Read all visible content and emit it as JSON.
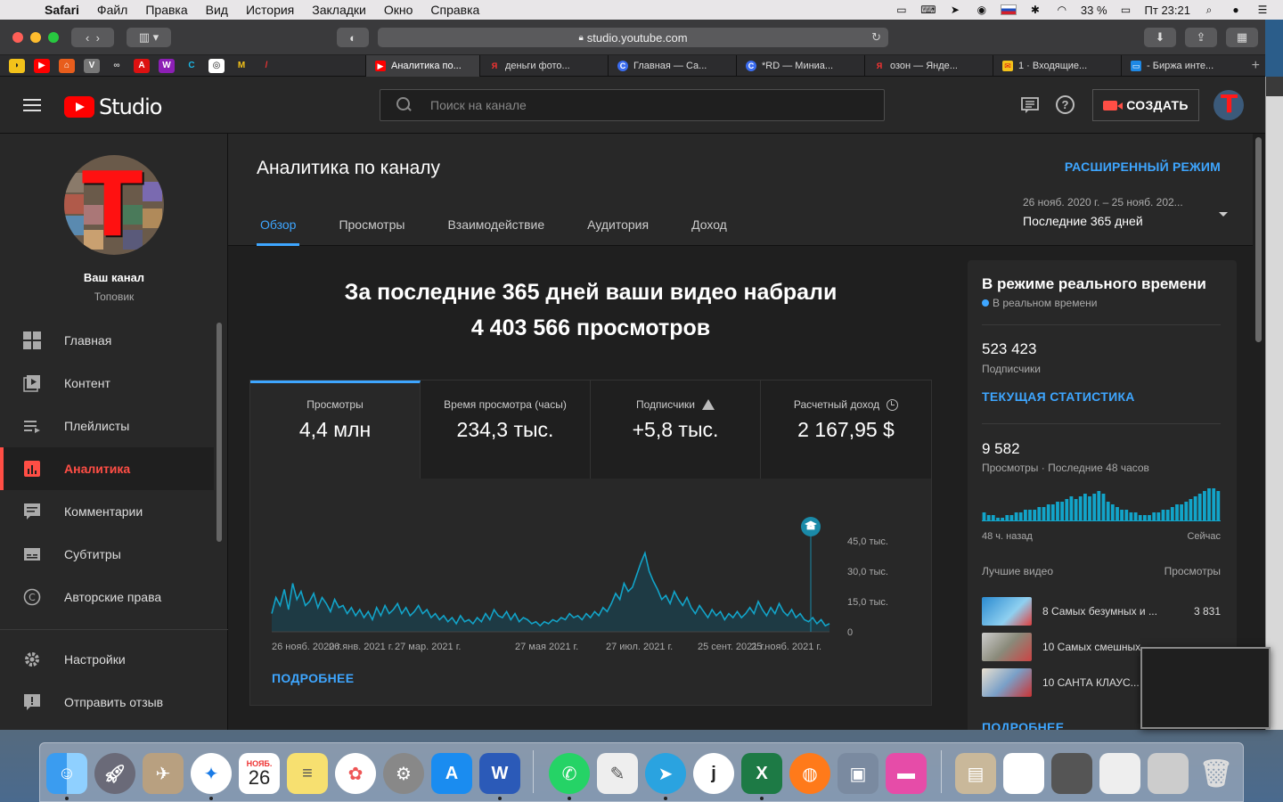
{
  "menubar": {
    "app": "Safari",
    "items": [
      "Файл",
      "Правка",
      "Вид",
      "История",
      "Закладки",
      "Окно",
      "Справка"
    ],
    "battery": "33 %",
    "clock": "Пт 23:21"
  },
  "browser": {
    "url": "studio.youtube.com",
    "tabs": [
      {
        "label": "Аналитика по...",
        "active": true
      },
      {
        "label": "деньги фото..."
      },
      {
        "label": "Главная — Са..."
      },
      {
        "label": "*RD — Миниа..."
      },
      {
        "label": "озон — Янде..."
      },
      {
        "label": "1 · Входящие..."
      },
      {
        "label": "- Биржа инте..."
      }
    ]
  },
  "header": {
    "logo": "Studio",
    "search_placeholder": "Поиск на канале",
    "create_label": "СОЗДАТЬ"
  },
  "sidebar": {
    "channel_name": "Ваш канал",
    "channel_sub": "Топовик",
    "items": [
      {
        "label": "Главная",
        "icon": "dashboard-icon"
      },
      {
        "label": "Контент",
        "icon": "content-icon"
      },
      {
        "label": "Плейлисты",
        "icon": "playlist-icon"
      },
      {
        "label": "Аналитика",
        "icon": "analytics-icon",
        "active": true
      },
      {
        "label": "Комментарии",
        "icon": "comments-icon"
      },
      {
        "label": "Субтитры",
        "icon": "subtitles-icon"
      },
      {
        "label": "Авторские права",
        "icon": "copyright-icon"
      }
    ],
    "bottom": [
      {
        "label": "Настройки",
        "icon": "gear-icon"
      },
      {
        "label": "Отправить отзыв",
        "icon": "feedback-icon"
      }
    ]
  },
  "main": {
    "title": "Аналитика по каналу",
    "advanced_mode": "РАСШИРЕННЫЙ РЕЖИМ",
    "tabs": [
      "Обзор",
      "Просмотры",
      "Взаимодействие",
      "Аудитория",
      "Доход"
    ],
    "date_range": "26 нояб. 2020 г. – 25 нояб. 202...",
    "date_label": "Последние 365 дней",
    "headline_1": "За последние 365 дней ваши видео набрали",
    "headline_2": "4 403 566 просмотров",
    "metrics": [
      {
        "label": "Просмотры",
        "value": "4,4 млн"
      },
      {
        "label": "Время просмотра (часы)",
        "value": "234,3 тыс."
      },
      {
        "label": "Подписчики",
        "value": "+5,8 тыс."
      },
      {
        "label": "Расчетный доход",
        "value": "2 167,95 $"
      }
    ],
    "more_link": "ПОДРОБНЕЕ"
  },
  "chart_data": {
    "type": "area",
    "ylabel_ticks": [
      "0",
      "15,0 тыс.",
      "30,0 тыс.",
      "45,0 тыс."
    ],
    "ylim": [
      0,
      45000
    ],
    "x_ticks": [
      "26 нояб. 2020 г.",
      "26 янв. 2021 г.",
      "27 мар. 2021 г.",
      "27 мая 2021 г.",
      "27 июл. 2021 г.",
      "25 сент. 2021 г.",
      "25 нояб. 2021 г."
    ],
    "grid": false,
    "color": "#12a4c9",
    "values": [
      9000,
      17000,
      13000,
      21000,
      11000,
      24000,
      16000,
      20000,
      13000,
      15000,
      19000,
      12000,
      17000,
      14000,
      10000,
      16000,
      12000,
      13000,
      9000,
      12000,
      8000,
      11000,
      7000,
      10000,
      6000,
      12000,
      8000,
      13000,
      9000,
      11000,
      14000,
      9000,
      12000,
      8000,
      10000,
      13000,
      9000,
      11000,
      7000,
      9000,
      6000,
      8000,
      5000,
      7000,
      4000,
      8000,
      5000,
      6000,
      4000,
      7000,
      5000,
      9000,
      6000,
      11000,
      8000,
      7000,
      10000,
      6000,
      9000,
      5000,
      7000,
      6000,
      4000,
      5000,
      3000,
      5000,
      4000,
      6000,
      5000,
      7000,
      6000,
      9000,
      7000,
      8000,
      6000,
      9000,
      7000,
      10000,
      8000,
      12000,
      10000,
      14000,
      19000,
      16000,
      24000,
      20000,
      22000,
      28000,
      34000,
      39000,
      30000,
      25000,
      21000,
      16000,
      18000,
      14000,
      20000,
      16000,
      13000,
      17000,
      12000,
      9000,
      13000,
      10000,
      7000,
      11000,
      8000,
      10000,
      6000,
      9000,
      7000,
      10000,
      7000,
      9000,
      12000,
      9000,
      15000,
      11000,
      8000,
      12000,
      9000,
      14000,
      10000,
      8000,
      11000,
      7000,
      9000,
      6000,
      5000,
      7000,
      4000,
      6000,
      3000,
      4000
    ],
    "highlight_label": "marker-icon"
  },
  "realtime": {
    "title": "В режиме реального времени",
    "live": "В реальном времени",
    "subs_value": "523 423",
    "subs_label": "Подписчики",
    "stats_link": "ТЕКУЩАЯ СТАТИСТИКА",
    "views_value": "9 582",
    "views_label": "Просмотры · Последние 48 часов",
    "axis_left": "48 ч. назад",
    "axis_right": "Сейчас",
    "bars": [
      3,
      2,
      2,
      1,
      1,
      2,
      2,
      3,
      3,
      4,
      4,
      4,
      5,
      5,
      6,
      6,
      7,
      7,
      8,
      9,
      8,
      9,
      10,
      9,
      10,
      11,
      10,
      7,
      6,
      5,
      4,
      4,
      3,
      3,
      2,
      2,
      2,
      3,
      3,
      4,
      4,
      5,
      6,
      6,
      7,
      8,
      9,
      10,
      11,
      12,
      12,
      11
    ],
    "top_head_left": "Лучшие видео",
    "top_head_right": "Просмотры",
    "videos": [
      {
        "title": "8 Самых безумных и ...",
        "views": "3 831"
      },
      {
        "title": "10 Самых смешных ...",
        "views": ""
      },
      {
        "title": "10 САНТА КЛАУС...",
        "views": ""
      }
    ],
    "more_link": "ПОДРОБНЕЕ"
  },
  "dock": {
    "calendar_month": "НОЯБ.",
    "calendar_day": "26"
  }
}
